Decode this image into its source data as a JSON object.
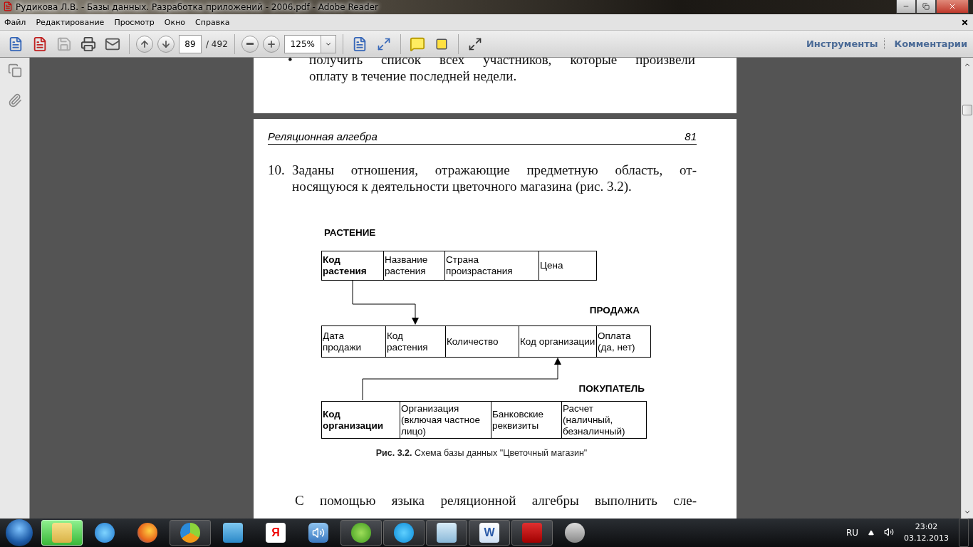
{
  "window": {
    "title": "Рудикова Л.В. - Базы данных. Разработка приложений - 2006.pdf - Adobe Reader"
  },
  "menu": [
    "Файл",
    "Редактирование",
    "Просмотр",
    "Окно",
    "Справка"
  ],
  "toolbar": {
    "page_number": "89",
    "page_total": "/ 492",
    "zoom": "125%",
    "links": [
      "Инструменты",
      "Комментарии"
    ]
  },
  "previous_page": {
    "bullet": "•",
    "lines": [
      "получить список всех участников, которые произвели",
      "оплату в течение последней недели."
    ]
  },
  "page": {
    "header_title": "Реляционная алгебра",
    "header_number": "81",
    "item_number": "10.",
    "item_lines": [
      "Заданы отношения, отражающие предметную область, от-",
      "носящуюся к деятельности цветочного магазина (рис. 3.2)."
    ],
    "diagram": {
      "tables": [
        {
          "name": "РАСТЕНИЕ",
          "cells": [
            {
              "text": "Код растения",
              "key": true
            },
            {
              "text": "Название растения",
              "key": false
            },
            {
              "text": "Страна произрастания",
              "key": false
            },
            {
              "text": "Цена",
              "key": false
            }
          ]
        },
        {
          "name": "ПРОДАЖА",
          "cells": [
            {
              "text": "Дата продажи",
              "key": false
            },
            {
              "text": "Код растения",
              "key": false
            },
            {
              "text": "Количество",
              "key": false
            },
            {
              "text": "Код организации",
              "key": false
            },
            {
              "text": "Оплата (да, нет)",
              "key": false
            }
          ]
        },
        {
          "name": "ПОКУПАТЕЛЬ",
          "cells": [
            {
              "text": "Код организации",
              "key": true
            },
            {
              "text": "Организация (включая частное лицо)",
              "key": false
            },
            {
              "text": "Банковские реквизиты",
              "key": false
            },
            {
              "text": "Расчет (наличный, безналичный)",
              "key": false
            }
          ]
        }
      ],
      "caption": "**Рис. 3.2.** Схема базы данных \"Цветочный магазин\""
    },
    "last_line": "С помощью языка реляционной алгебры выполнить сле-"
  },
  "taskbar": {
    "items": [
      {
        "kind": "folder",
        "running": true
      },
      {
        "kind": "ie",
        "running": false
      },
      {
        "kind": "firefox",
        "running": false
      },
      {
        "kind": "circle",
        "running": true
      },
      {
        "kind": "media",
        "running": false
      },
      {
        "kind": "yandex",
        "running": false,
        "glyph": "Я"
      },
      {
        "kind": "speaker",
        "running": false
      },
      {
        "kind": "utorrent",
        "running": true
      },
      {
        "kind": "skype",
        "running": true
      },
      {
        "kind": "calculator",
        "running": true
      },
      {
        "kind": "word",
        "running": true,
        "glyph": "W"
      },
      {
        "kind": "acrobat",
        "running": true
      },
      {
        "kind": "keys",
        "running": false
      }
    ],
    "language": "RU",
    "time": "23:02",
    "date": "03.12.2013"
  }
}
